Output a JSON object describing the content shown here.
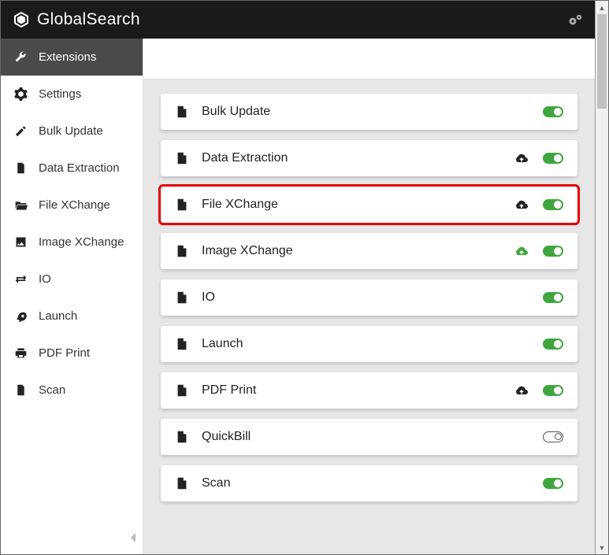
{
  "brand": {
    "name": "GlobalSearch"
  },
  "sidebar": {
    "items": [
      {
        "label": "Extensions",
        "icon": "wrench",
        "active": true
      },
      {
        "label": "Settings",
        "icon": "gear"
      },
      {
        "label": "Bulk Update",
        "icon": "edit"
      },
      {
        "label": "Data Extraction",
        "icon": "file-lines"
      },
      {
        "label": "File XChange",
        "icon": "folder-open"
      },
      {
        "label": "Image XChange",
        "icon": "image"
      },
      {
        "label": "IO",
        "icon": "arrows"
      },
      {
        "label": "Launch",
        "icon": "rocket"
      },
      {
        "label": "PDF Print",
        "icon": "print"
      },
      {
        "label": "Scan",
        "icon": "scan"
      }
    ]
  },
  "extensions": [
    {
      "label": "Bulk Update",
      "cloud": null,
      "enabled": true,
      "highlight": false
    },
    {
      "label": "Data Extraction",
      "cloud": "black",
      "enabled": true,
      "highlight": false
    },
    {
      "label": "File XChange",
      "cloud": "black",
      "enabled": true,
      "highlight": true
    },
    {
      "label": "Image XChange",
      "cloud": "green",
      "enabled": true,
      "highlight": false
    },
    {
      "label": "IO",
      "cloud": null,
      "enabled": true,
      "highlight": false
    },
    {
      "label": "Launch",
      "cloud": null,
      "enabled": true,
      "highlight": false
    },
    {
      "label": "PDF Print",
      "cloud": "black",
      "enabled": true,
      "highlight": false
    },
    {
      "label": "QuickBill",
      "cloud": null,
      "enabled": false,
      "highlight": false
    },
    {
      "label": "Scan",
      "cloud": null,
      "enabled": true,
      "highlight": false
    }
  ]
}
